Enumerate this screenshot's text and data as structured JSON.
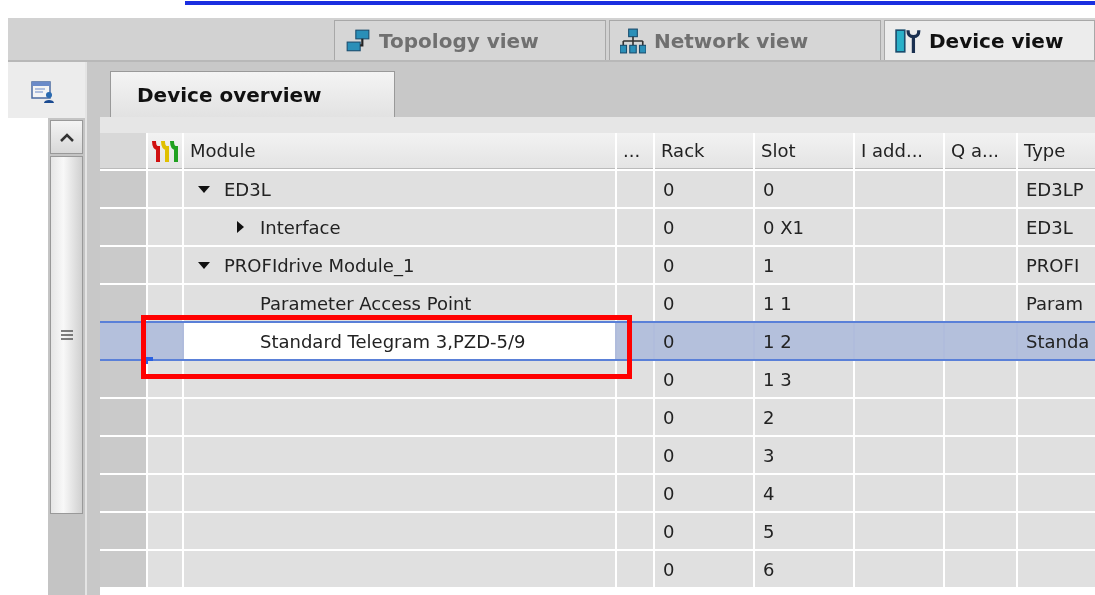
{
  "view_tabs": [
    {
      "label": "Topology view",
      "kind": "topology",
      "selected": false
    },
    {
      "label": "Network view",
      "kind": "network",
      "selected": false
    },
    {
      "label": "Device view",
      "kind": "device",
      "selected": true
    }
  ],
  "panel_tab": {
    "label": "Device overview",
    "selected": true
  },
  "table": {
    "columns": [
      "Module",
      "...",
      "Rack",
      "Slot",
      "I add...",
      "Q a...",
      "Type"
    ],
    "rows": [
      {
        "module": "ED3L",
        "expanded": true,
        "rack": "0",
        "slot": "0",
        "type": "ED3LP",
        "selected": false,
        "children": [
          {
            "module": "Interface",
            "expanded": false,
            "rack": "0",
            "slot": "0 X1",
            "type": "ED3L",
            "selected": false
          }
        ]
      },
      {
        "module": "PROFIdrive Module_1",
        "expanded": true,
        "rack": "0",
        "slot": "1",
        "type": "PROFI",
        "selected": false,
        "children": [
          {
            "module": "Parameter Access Point",
            "rack": "0",
            "slot": "1 1",
            "type": "Param",
            "selected": false
          },
          {
            "module": "Standard Telegram 3,PZD-5/9",
            "rack": "0",
            "slot": "1 2",
            "type": "Standa",
            "selected": true
          }
        ]
      },
      {
        "rack": "0",
        "slot": "1 3",
        "selected": false
      },
      {
        "rack": "0",
        "slot": "2",
        "selected": false
      },
      {
        "rack": "0",
        "slot": "3",
        "selected": false
      },
      {
        "rack": "0",
        "slot": "4",
        "selected": false
      },
      {
        "rack": "0",
        "slot": "5",
        "selected": false
      },
      {
        "rack": "0",
        "slot": "6",
        "selected": false
      }
    ]
  }
}
